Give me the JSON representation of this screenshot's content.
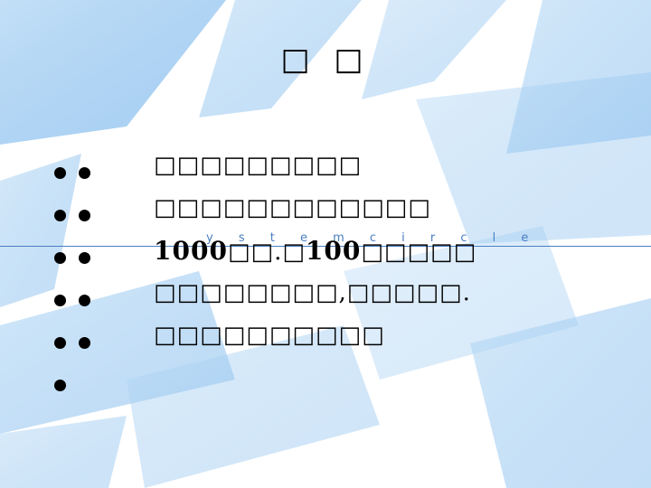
{
  "title": "□ □",
  "bullets": {
    "rows": [
      2,
      2,
      2,
      2,
      2,
      1
    ]
  },
  "lines": [
    {
      "text": "□□□□□□□□□"
    },
    {
      "prefix": "",
      "text": "□□□□□□□□□□□□"
    },
    {
      "num1": "1000",
      "mid": "□□.□",
      "num2": "100",
      "tail": "□□□□□"
    },
    {
      "text": "□□□□□□□□,□□□□□."
    },
    {
      "text": "□□□□□□□□□□"
    }
  ],
  "watermark": "y s t e m   c i r c l e",
  "colors": {
    "accent": "#4a7fc0",
    "background_wash": "#9cc8f0"
  }
}
